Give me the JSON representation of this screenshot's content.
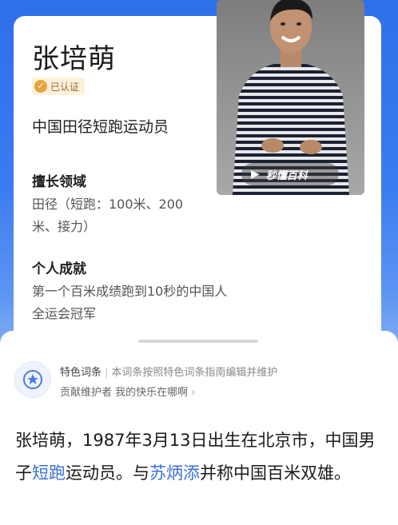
{
  "person": {
    "name": "张培萌",
    "verified_label": "已认证",
    "title": "中国田径短跑运动员"
  },
  "sections": [
    {
      "heading": "擅长领域",
      "lines": [
        "田径（短跑：100米、200",
        "米、接力）"
      ]
    },
    {
      "heading": "个人成就",
      "lines": [
        "第一个百米成绩跑到10秒的中国人",
        "全运会冠军"
      ]
    }
  ],
  "photo": {
    "watermark": "秒懂百科",
    "icon": "play-icon"
  },
  "feature": {
    "label": "特色词条",
    "description": "本词条按照特色词条指南编辑并维护",
    "contributor_label": "贡献维护者",
    "contributor_name": "我的快乐在哪啊",
    "icon": "feature-badge-icon"
  },
  "intro": {
    "part1": "张培萌，1987年3月13日出生在北京市，中国男子",
    "link1": "短跑",
    "part2": "运动员。与",
    "link2": "苏炳添",
    "part3": "并称中国百米双雄。"
  },
  "colors": {
    "accent_link": "#3a6fd8",
    "verified_badge": "#e7a43a",
    "background_blue": "#2f6fe8"
  }
}
